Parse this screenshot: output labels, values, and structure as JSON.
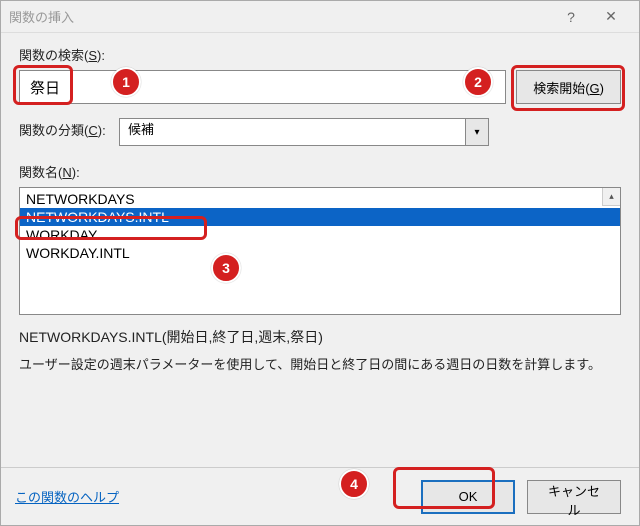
{
  "window": {
    "title": "関数の挿入"
  },
  "titlebar": {
    "help": "?",
    "close": "✕"
  },
  "search": {
    "label_pre": "関数の検索(",
    "label_key": "S",
    "label_post": "):",
    "value": "祭日"
  },
  "go_button": {
    "label_pre": "検索開始(",
    "label_key": "G",
    "label_post": ")"
  },
  "category": {
    "label_pre": "関数の分類(",
    "label_key": "C",
    "label_post": "):",
    "selected": "候補"
  },
  "funcname": {
    "label_pre": "関数名(",
    "label_key": "N",
    "label_post": "):"
  },
  "functions": [
    {
      "name": "NETWORKDAYS",
      "selected": false
    },
    {
      "name": "NETWORKDAYS.INTL",
      "selected": true
    },
    {
      "name": "WORKDAY",
      "selected": false
    },
    {
      "name": "WORKDAY.INTL",
      "selected": false
    }
  ],
  "signature": "NETWORKDAYS.INTL(開始日,終了日,週末,祭日)",
  "description": "ユーザー設定の週末パラメーターを使用して、開始日と終了日の間にある週日の日数を計算します。",
  "help_link": "この関数のヘルプ",
  "buttons": {
    "ok": "OK",
    "cancel": "キャンセル"
  },
  "annotations": {
    "n1": "1",
    "n2": "2",
    "n3": "3",
    "n4": "4"
  }
}
